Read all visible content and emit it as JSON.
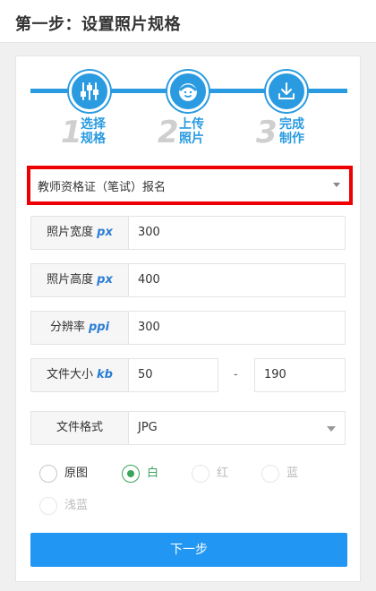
{
  "header": {
    "title": "第一步：设置照片规格"
  },
  "steps": [
    {
      "number": "1",
      "label": "选择规格",
      "icon": "sliders-icon"
    },
    {
      "number": "2",
      "label": "上传照片",
      "icon": "face-icon"
    },
    {
      "number": "3",
      "label": "完成制作",
      "icon": "download-icon"
    }
  ],
  "spec_select": {
    "value": "教师资格证（笔试）报名"
  },
  "fields": {
    "width": {
      "label": "照片宽度",
      "unit": "px",
      "value": "300"
    },
    "height": {
      "label": "照片高度",
      "unit": "px",
      "value": "400"
    },
    "resolution": {
      "label": "分辨率",
      "unit": "ppi",
      "value": "300"
    },
    "filesize": {
      "label": "文件大小",
      "unit": "kb",
      "min": "50",
      "separator": "-",
      "max": "190"
    },
    "format": {
      "label": "文件格式",
      "value": "JPG"
    }
  },
  "background_options": [
    {
      "label": "原图",
      "state": "enabled"
    },
    {
      "label": "白",
      "state": "checked"
    },
    {
      "label": "红",
      "state": "disabled"
    },
    {
      "label": "蓝",
      "state": "disabled"
    },
    {
      "label": "浅蓝",
      "state": "disabled"
    }
  ],
  "next_button": {
    "label": "下一步"
  },
  "colors": {
    "accent": "#2a9be0",
    "button": "#2196f3",
    "highlight": "#ee0000",
    "checked": "#3aa45b"
  }
}
